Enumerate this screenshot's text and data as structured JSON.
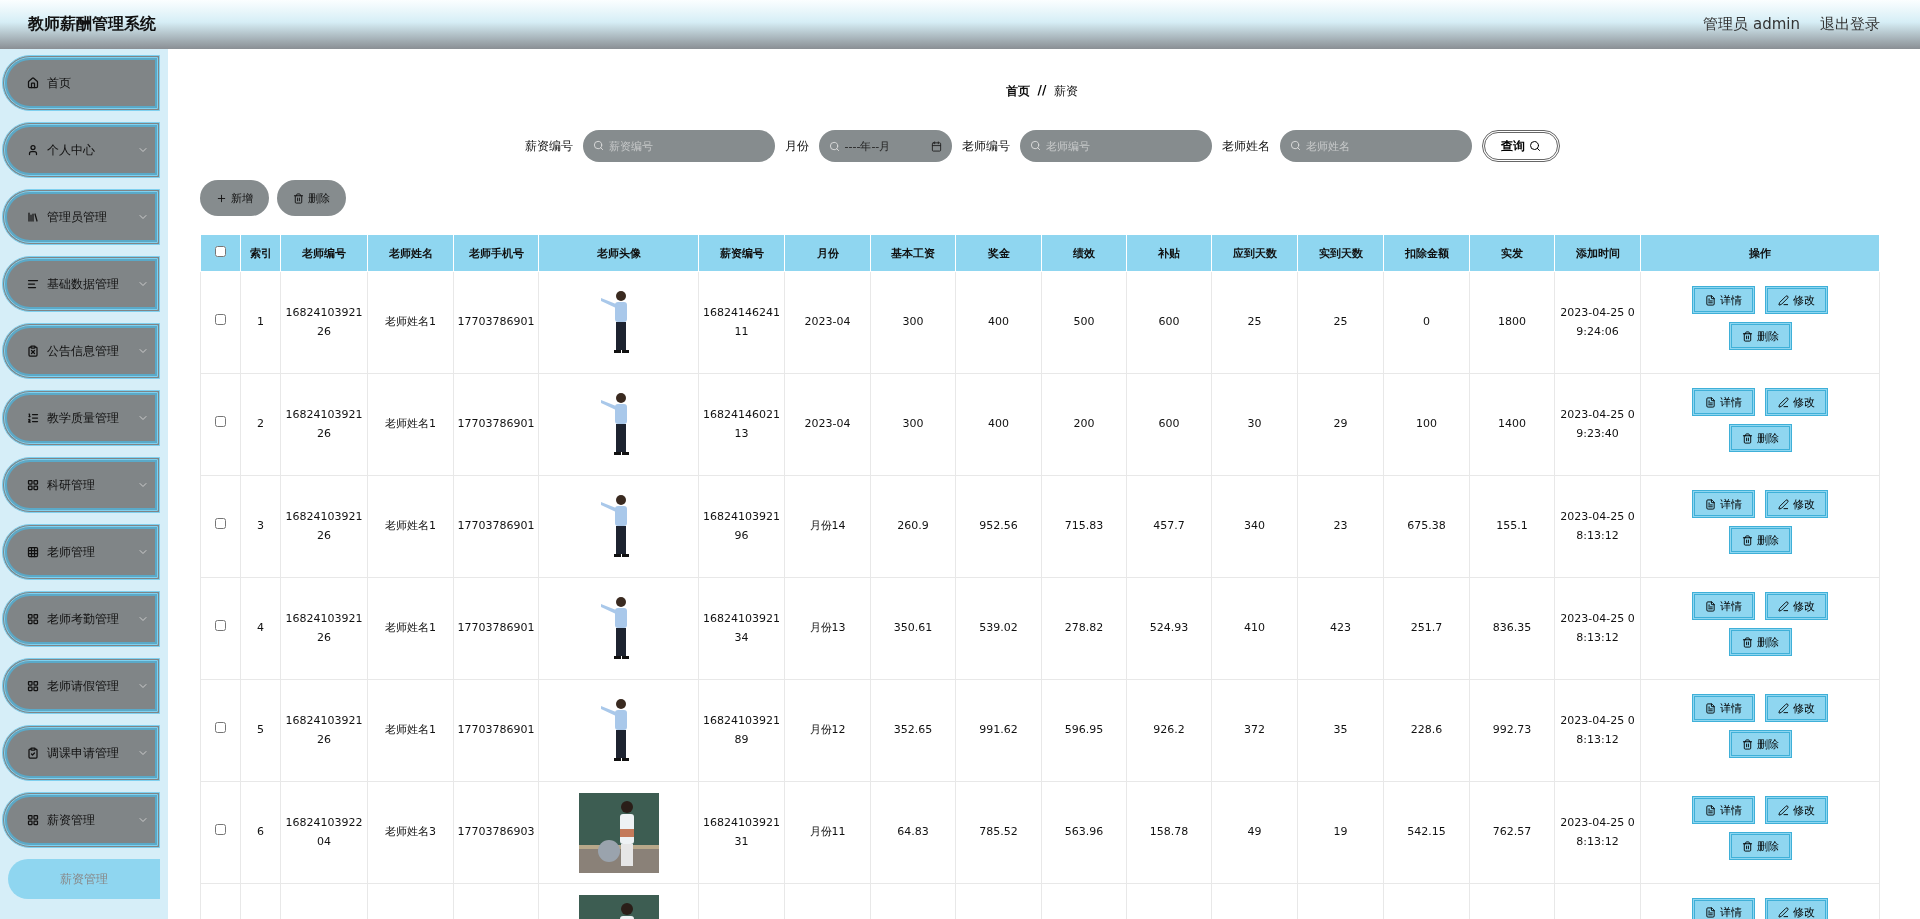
{
  "header": {
    "title": "教师薪酬管理系统",
    "user": "管理员 admin",
    "logout": "退出登录"
  },
  "sidebar": {
    "items": [
      {
        "label": "首页",
        "expandable": false
      },
      {
        "label": "个人中心",
        "expandable": true
      },
      {
        "label": "管理员管理",
        "expandable": true
      },
      {
        "label": "基础数据管理",
        "expandable": true
      },
      {
        "label": "公告信息管理",
        "expandable": true
      },
      {
        "label": "教学质量管理",
        "expandable": true
      },
      {
        "label": "科研管理",
        "expandable": true
      },
      {
        "label": "老师管理",
        "expandable": true
      },
      {
        "label": "老师考勤管理",
        "expandable": true
      },
      {
        "label": "老师请假管理",
        "expandable": true
      },
      {
        "label": "调课申请管理",
        "expandable": true
      },
      {
        "label": "薪资管理",
        "expandable": true,
        "children": [
          {
            "label": "薪资管理",
            "selected": true
          }
        ]
      }
    ]
  },
  "breadcrumb": {
    "home": "首页",
    "separator": "//",
    "current": "薪资"
  },
  "search": {
    "fields": [
      {
        "label": "薪资编号",
        "placeholder": "薪资编号",
        "kind": "text"
      },
      {
        "label": "月份",
        "placeholder": "----年--月",
        "kind": "month"
      },
      {
        "label": "老师编号",
        "placeholder": "老师编号",
        "kind": "text"
      },
      {
        "label": "老师姓名",
        "placeholder": "老师姓名",
        "kind": "text"
      }
    ],
    "button": "查询"
  },
  "toolbar": {
    "add": "新增",
    "delete": "删除"
  },
  "table": {
    "select_all": {
      "checked": false
    },
    "columns": [
      "索引",
      "老师编号",
      "老师姓名",
      "老师手机号",
      "老师头像",
      "薪资编号",
      "月份",
      "基本工资",
      "奖金",
      "绩效",
      "补贴",
      "应到天数",
      "实到天数",
      "扣除金额",
      "实发",
      "添加时间",
      "操作"
    ],
    "rows": [
      {
        "checked": false,
        "cells": [
          "1",
          "1682410392126",
          "老师姓名1",
          "17703786901",
          null,
          "1682414624111",
          "2023-04",
          "300",
          "400",
          "500",
          "600",
          "25",
          "25",
          "0",
          "1800",
          "2023-04-25 09:24:06"
        ],
        "photo": {
          "kind": "picture"
        },
        "actions": [
          "详情",
          "修改",
          "删除"
        ]
      },
      {
        "checked": false,
        "cells": [
          "2",
          "1682410392126",
          "老师姓名1",
          "17703786901",
          null,
          "1682414602113",
          "2023-04",
          "300",
          "400",
          "200",
          "600",
          "30",
          "29",
          "100",
          "1400",
          "2023-04-25 09:23:40"
        ],
        "photo": {
          "kind": "picture"
        },
        "actions": [
          "详情",
          "修改",
          "删除"
        ]
      },
      {
        "checked": false,
        "cells": [
          "3",
          "1682410392126",
          "老师姓名1",
          "17703786901",
          null,
          "1682410392196",
          "月份14",
          "260.9",
          "952.56",
          "715.83",
          "457.7",
          "340",
          "23",
          "675.38",
          "155.1",
          "2023-04-25 08:13:12"
        ],
        "photo": {
          "kind": "picture"
        },
        "actions": [
          "详情",
          "修改",
          "删除"
        ]
      },
      {
        "checked": false,
        "cells": [
          "4",
          "1682410392126",
          "老师姓名1",
          "17703786901",
          null,
          "1682410392134",
          "月份13",
          "350.61",
          "539.02",
          "278.82",
          "524.93",
          "410",
          "423",
          "251.7",
          "836.35",
          "2023-04-25 08:13:12"
        ],
        "photo": {
          "kind": "picture"
        },
        "actions": [
          "详情",
          "修改",
          "删除"
        ]
      },
      {
        "checked": false,
        "cells": [
          "5",
          "1682410392126",
          "老师姓名1",
          "17703786901",
          null,
          "1682410392189",
          "月份12",
          "352.65",
          "991.62",
          "596.95",
          "926.2",
          "372",
          "35",
          "228.6",
          "992.73",
          "2023-04-25 08:13:12"
        ],
        "photo": {
          "kind": "picture"
        },
        "actions": [
          "详情",
          "修改",
          "删除"
        ]
      },
      {
        "checked": false,
        "cells": [
          "6",
          "1682410392204",
          "老师姓名3",
          "17703786903",
          null,
          "1682410392131",
          "月份11",
          "64.83",
          "785.52",
          "563.96",
          "158.78",
          "49",
          "19",
          "542.15",
          "762.57",
          "2023-04-25 08:13:12"
        ],
        "photo": {
          "kind": "picture"
        },
        "actions": [
          "详情",
          "修改",
          "删除"
        ]
      },
      {
        "photo": {
          "kind": "picture"
        },
        "actions": [
          "详情",
          "修改"
        ]
      }
    ]
  }
}
